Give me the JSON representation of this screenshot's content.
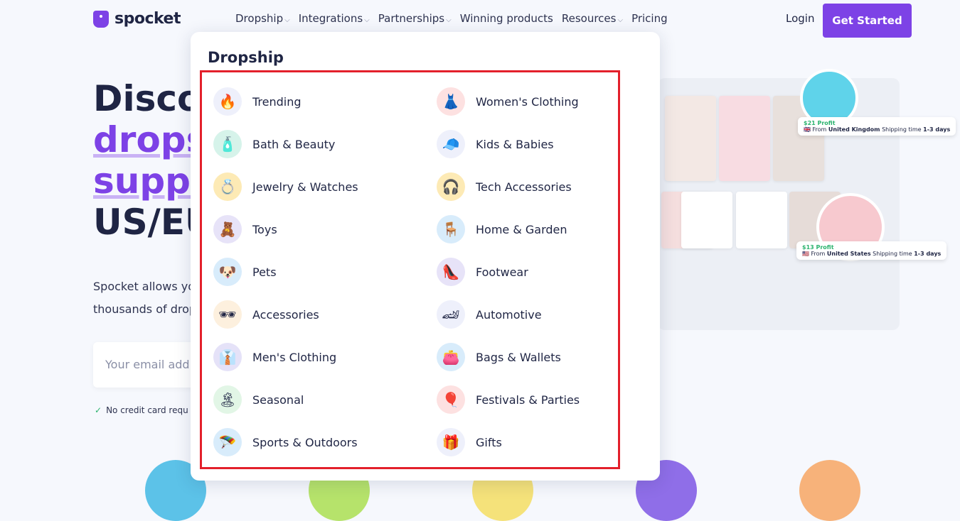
{
  "brand": {
    "name": "spocket",
    "color": "#7d42e6"
  },
  "nav": {
    "items": [
      {
        "label": "Dropship",
        "chevron": true
      },
      {
        "label": "Integrations",
        "chevron": true
      },
      {
        "label": "Partnerships",
        "chevron": true
      },
      {
        "label": "Winning products",
        "chevron": false
      },
      {
        "label": "Resources",
        "chevron": true
      },
      {
        "label": "Pricing",
        "chevron": false
      }
    ],
    "login": "Login",
    "get_started": "Get Started"
  },
  "hero": {
    "line1": "Disco",
    "line2": "drops",
    "line3": "suppl",
    "line4": "US/EU",
    "para1": "Spocket allows yo",
    "para2": "thousands of drop",
    "email_placeholder": "Your email add",
    "no_credit": "No credit card requ"
  },
  "showcase": {
    "uk": {
      "profit": "$21 Profit",
      "from_label": "From",
      "from": "United Kingdom",
      "ship_label": "Shipping time",
      "ship": "1-3 days"
    },
    "us": {
      "profit": "$13 Profit",
      "from_label": "From",
      "from": "United States",
      "ship_label": "Shipping time",
      "ship": "1-3 days"
    }
  },
  "dropdown": {
    "title": "Dropship",
    "highlight_color": "#e3202b",
    "left": [
      {
        "label": "Trending",
        "icon": "fire-icon",
        "glyph": "🔥",
        "bg": "#eef0fb"
      },
      {
        "label": "Bath & Beauty",
        "icon": "beauty-icon",
        "glyph": "🧴",
        "bg": "#d6f3ea"
      },
      {
        "label": "Jewelry & Watches",
        "icon": "ring-icon",
        "glyph": "💍",
        "bg": "#fdeab5"
      },
      {
        "label": "Toys",
        "icon": "teddy-bear-icon",
        "glyph": "🧸",
        "bg": "#e7e3f8"
      },
      {
        "label": "Pets",
        "icon": "dog-icon",
        "glyph": "🐶",
        "bg": "#d8ecfb"
      },
      {
        "label": "Accessories",
        "icon": "sunglasses-icon",
        "glyph": "🕶",
        "bg": "#fdf0de"
      },
      {
        "label": "Men's Clothing",
        "icon": "tie-icon",
        "glyph": "👔",
        "bg": "#e5e2f8"
      },
      {
        "label": "Seasonal",
        "icon": "palm-tree-icon",
        "glyph": "🏝",
        "bg": "#e2f6e6"
      },
      {
        "label": "Sports & Outdoors",
        "icon": "parachute-icon",
        "glyph": "🪂",
        "bg": "#d8ecfb"
      }
    ],
    "right": [
      {
        "label": "Women's Clothing",
        "icon": "dress-icon",
        "glyph": "👗",
        "bg": "#fde1e1"
      },
      {
        "label": "Kids & Babies",
        "icon": "cap-icon",
        "glyph": "🧢",
        "bg": "#eef0fb"
      },
      {
        "label": "Tech Accessories",
        "icon": "earbuds-icon",
        "glyph": "🎧",
        "bg": "#fdeab5"
      },
      {
        "label": "Home & Garden",
        "icon": "chair-icon",
        "glyph": "🪑",
        "bg": "#d8ecfb"
      },
      {
        "label": "Footwear",
        "icon": "heel-icon",
        "glyph": "👠",
        "bg": "#e7e3f8"
      },
      {
        "label": "Automotive",
        "icon": "car-icon",
        "glyph": "🏎",
        "bg": "#eef0fb"
      },
      {
        "label": "Bags & Wallets",
        "icon": "purse-icon",
        "glyph": "👛",
        "bg": "#d8ecfb"
      },
      {
        "label": "Festivals & Parties",
        "icon": "balloons-icon",
        "glyph": "🎈",
        "bg": "#fde1e1"
      },
      {
        "label": "Gifts",
        "icon": "gift-icon",
        "glyph": "🎁",
        "bg": "#eef0fb"
      }
    ]
  }
}
